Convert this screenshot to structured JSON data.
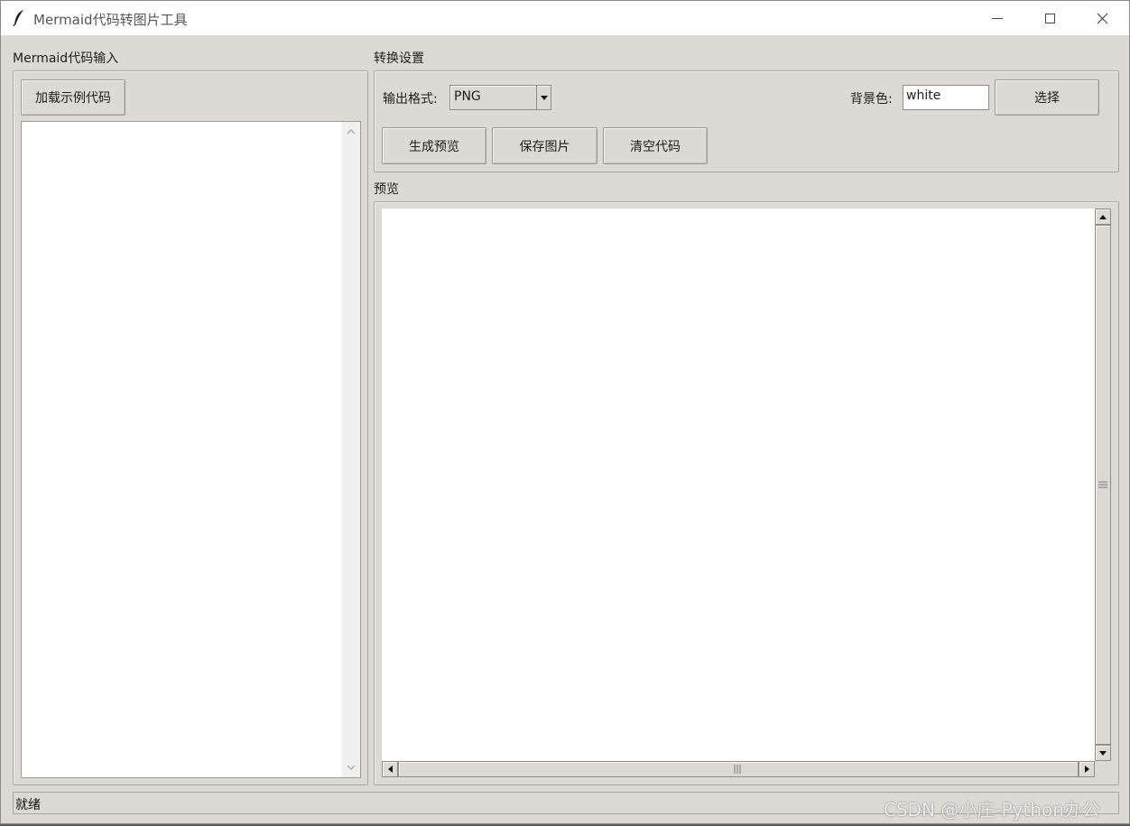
{
  "window": {
    "title": "Mermaid代码转图片工具"
  },
  "left": {
    "section_label": "Mermaid代码输入",
    "load_example_label": "加载示例代码",
    "code_text": ""
  },
  "settings": {
    "section_label": "转换设置",
    "format_label": "输出格式:",
    "format_value": "PNG",
    "bg_label": "背景色:",
    "bg_value": "white",
    "choose_label": "选择",
    "generate_label": "生成预览",
    "save_label": "保存图片",
    "clear_label": "清空代码"
  },
  "preview": {
    "section_label": "预览"
  },
  "status": {
    "text": "就绪"
  },
  "watermark": "CSDN @小庄-Python办公",
  "icons": {
    "app": "feather-icon",
    "minimize": "minimize-icon",
    "maximize": "maximize-icon",
    "close": "close-icon"
  },
  "colors": {
    "window_bg": "#dcdad5",
    "titlebar_bg": "#ffffff",
    "canvas_bg": "#ffffff"
  }
}
